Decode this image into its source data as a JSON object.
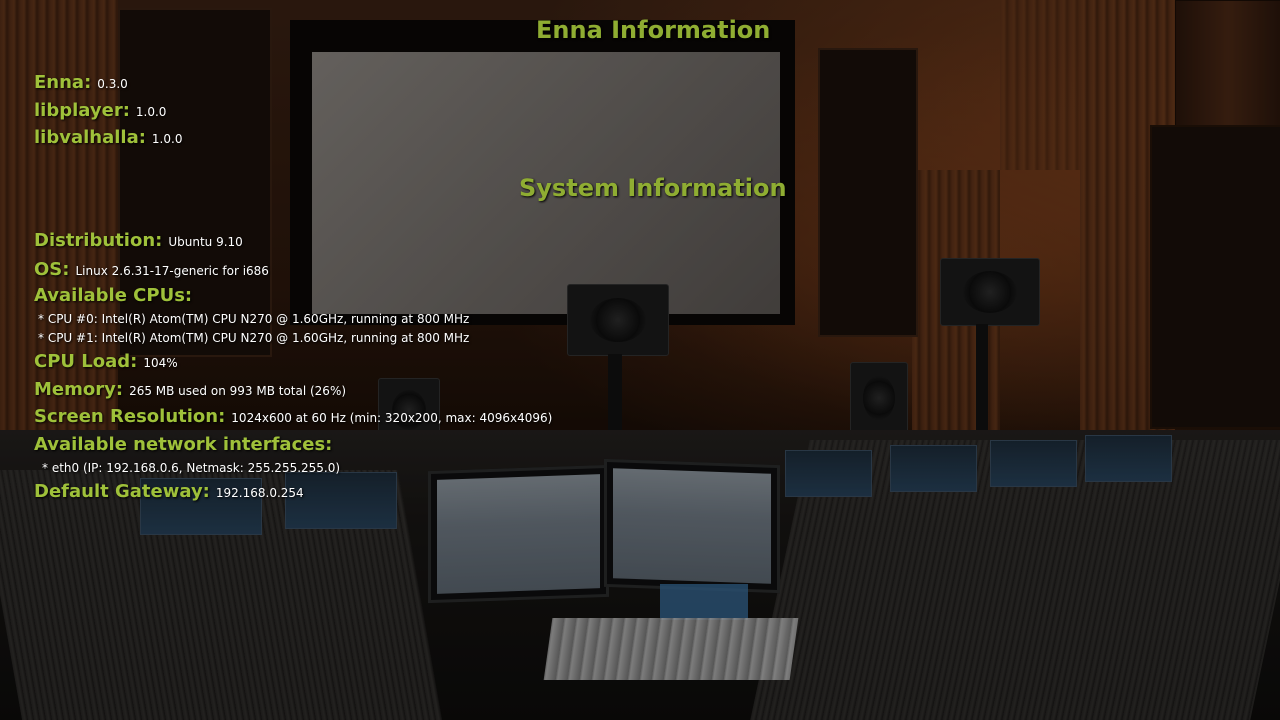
{
  "enna_section": {
    "title": "Enna Information",
    "items": [
      {
        "label": "Enna:",
        "value": "0.3.0"
      },
      {
        "label": "libplayer:",
        "value": "1.0.0"
      },
      {
        "label": "libvalhalla:",
        "value": "1.0.0"
      }
    ]
  },
  "system_section": {
    "title": "System Information",
    "distribution": {
      "label": "Distribution:",
      "value": "Ubuntu 9.10"
    },
    "os": {
      "label": "OS:",
      "value": "Linux 2.6.31-17-generic for i686"
    },
    "cpus": {
      "label": "Available CPUs:",
      "entries": [
        "* CPU #0: Intel(R) Atom(TM) CPU N270 @ 1.60GHz, running at 800 MHz",
        "* CPU #1: Intel(R) Atom(TM) CPU N270 @ 1.60GHz, running at 800 MHz"
      ]
    },
    "cpu_load": {
      "label": "CPU Load:",
      "value": "104%"
    },
    "memory": {
      "label": "Memory:",
      "value": "265 MB used on 993 MB total (26%)"
    },
    "screen_resolution": {
      "label": "Screen Resolution:",
      "value": "1024x600 at 60 Hz (min: 320x200, max: 4096x4096)"
    },
    "network": {
      "label": "Available network interfaces:",
      "entries": [
        "* eth0 (IP: 192.168.0.6, Netmask: 255.255.255.0)"
      ]
    },
    "gateway": {
      "label": "Default Gateway:",
      "value": "192.168.0.254"
    }
  },
  "colors": {
    "heading": "#8fad32",
    "label": "#9fc13a",
    "value": "#ffffff"
  },
  "background": "recording-studio-photo"
}
